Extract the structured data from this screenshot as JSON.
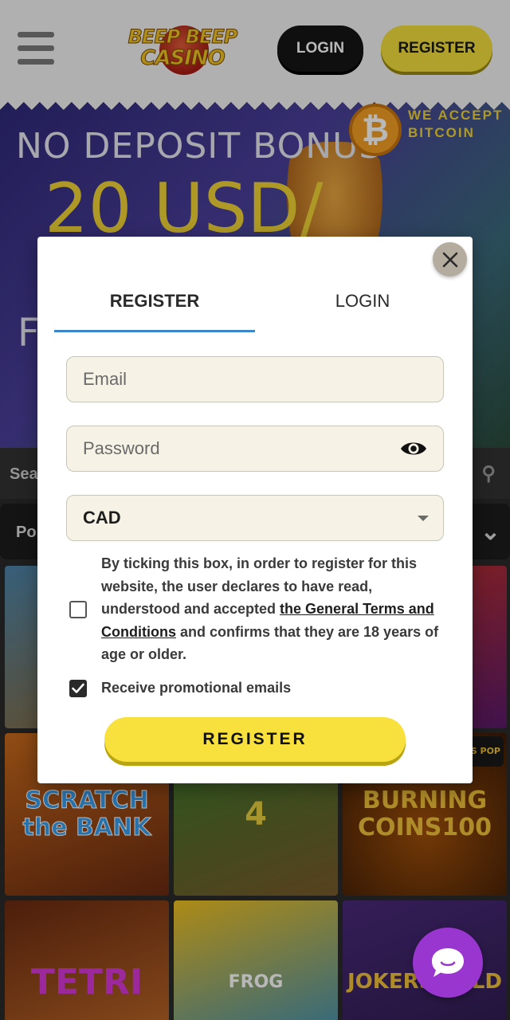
{
  "header": {
    "logo_line1": "BEEP BEEP",
    "logo_line2": "CASINO",
    "login_label": "LOGIN",
    "register_label": "REGISTER"
  },
  "banner": {
    "line1": "NO DEPOSIT BONUS",
    "line2": "20 USD/",
    "line3": "F",
    "bitcoin_badge": "WE ACCEPT BITCOIN",
    "bitcoin_symbol": "₿"
  },
  "search": {
    "label": "Sea"
  },
  "filter": {
    "label": "Po"
  },
  "games": {
    "tile4": "SCRATCH the BANK",
    "tile5": "4",
    "tile6": "BURNING COINS100",
    "tile6_badge": "BONUS POP",
    "tile7": "TETRI",
    "tile8": "FROG",
    "tile9": "JOKERS WILD"
  },
  "modal": {
    "tabs": {
      "register": "REGISTER",
      "login": "LOGIN"
    },
    "email_placeholder": "Email",
    "password_placeholder": "Password",
    "currency_value": "CAD",
    "terms_before": "By ticking this box, in order to register for this website, the user declares to have read, understood and accepted ",
    "terms_link": "the General Terms and Conditions",
    "terms_after": " and confirms that they are 18 years of age or older.",
    "terms_checked": false,
    "promo_label": "Receive promotional emails",
    "promo_checked": true,
    "submit_label": "REGISTER"
  },
  "colors": {
    "accent_yellow": "#f8e13c",
    "tab_underline": "#3a86c8",
    "chat_purple": "#9a36d0",
    "field_bg": "#f6f2e6"
  }
}
